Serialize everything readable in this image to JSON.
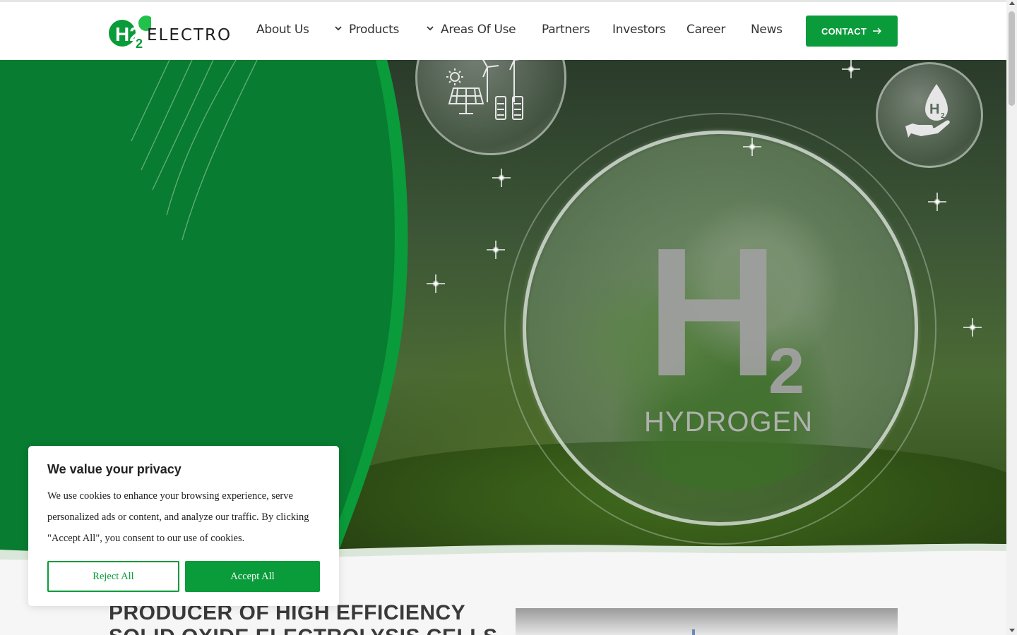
{
  "header": {
    "logo_text": "ELECTRO",
    "logo_mark": "H2",
    "nav": {
      "about": "About Us",
      "products": "Products",
      "areas": "Areas Of Use",
      "partners": "Partners",
      "investors": "Investors",
      "career": "Career",
      "news": "News"
    },
    "contact_label": "CONTACT"
  },
  "hero": {
    "image_text_main": "H",
    "image_text_sub": "2",
    "image_text_word": "HYDROGEN",
    "bubble_icon_text": "H"
  },
  "main": {
    "headline_line1": "PRODUCER OF HIGH EFFICIENCY",
    "headline_line2": "SOLID OXIDE ELECTROLYSIS CELLS"
  },
  "cookie": {
    "title": "We value your privacy",
    "text": "We use cookies to enhance your browsing experience, serve personalized ads or content, and analyze our traffic. By clicking \"Accept All\", you consent to our use of cookies.",
    "reject_label": "Reject All",
    "accept_label": "Accept All"
  },
  "colors": {
    "brand_green": "#0a9b3a",
    "hero_green": "#087c30",
    "text_dark": "#333333"
  },
  "icons": [
    "chevron-down-icon",
    "arrow-right-icon",
    "solar-wind-icon",
    "hydrogen-hand-icon"
  ]
}
